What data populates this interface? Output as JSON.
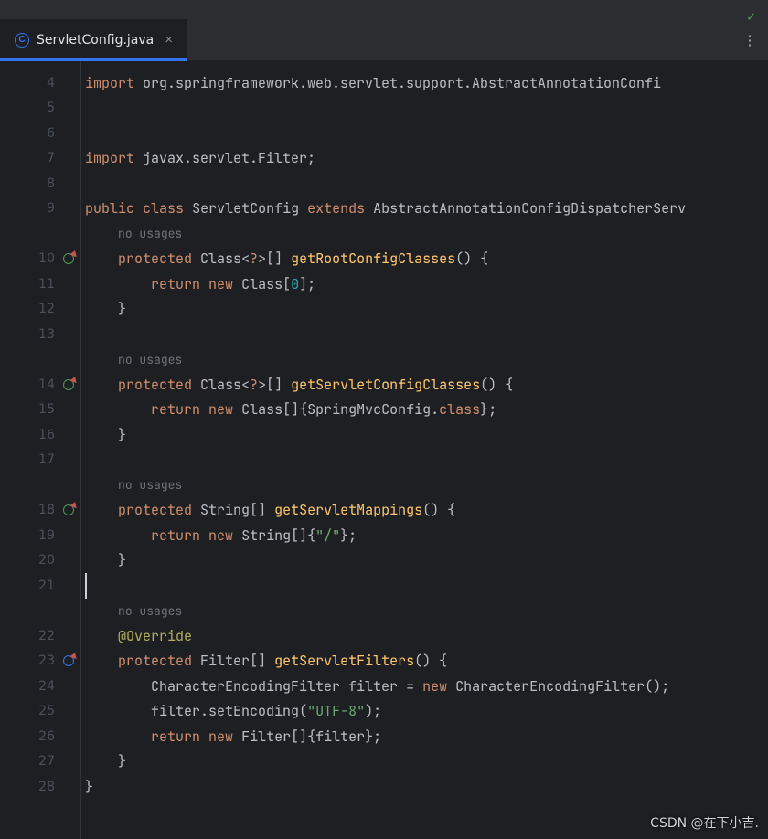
{
  "tab": {
    "icon_letter": "C",
    "title": "ServletConfig.java",
    "close_glyph": "×"
  },
  "tabbar": {
    "more_glyph": "⋮"
  },
  "status": {
    "check_glyph": "✓"
  },
  "hints": {
    "no_usages": "no usages"
  },
  "lines": {
    "l4": {
      "n": "4"
    },
    "l5": {
      "n": "5"
    },
    "l6": {
      "n": "6"
    },
    "l7": {
      "n": "7"
    },
    "l8": {
      "n": "8"
    },
    "l9": {
      "n": "9"
    },
    "l10": {
      "n": "10"
    },
    "l11": {
      "n": "11"
    },
    "l12": {
      "n": "12"
    },
    "l13": {
      "n": "13"
    },
    "l14": {
      "n": "14"
    },
    "l15": {
      "n": "15"
    },
    "l16": {
      "n": "16"
    },
    "l17": {
      "n": "17"
    },
    "l18": {
      "n": "18"
    },
    "l19": {
      "n": "19"
    },
    "l20": {
      "n": "20"
    },
    "l21": {
      "n": "21"
    },
    "l22": {
      "n": "22"
    },
    "l23": {
      "n": "23"
    },
    "l24": {
      "n": "24"
    },
    "l25": {
      "n": "25"
    },
    "l26": {
      "n": "26"
    },
    "l27": {
      "n": "27"
    },
    "l28": {
      "n": "28"
    }
  },
  "code": {
    "kw_import": "import",
    "kw_public": "public",
    "kw_class": "class",
    "kw_extends": "extends",
    "kw_protected": "protected",
    "kw_return": "return",
    "kw_new": "new",
    "ann_override": "@Override",
    "sp": " ",
    "pkg_spring": "org.springframework.web.servlet.support.AbstractAnnotationConfi",
    "pkg_filter": "javax.servlet.Filter;",
    "cls_ServletConfig": "ServletConfig",
    "cls_AbstractDispatcher": "AbstractAnnotationConfigDispatcherServ",
    "t_Class": "Class",
    "t_String": "String",
    "t_Filter": "Filter",
    "t_CEF": "CharacterEncodingFilter",
    "m_getRoot": "getRootConfigClasses",
    "m_getServletCfg": "getServletConfigClasses",
    "m_getMappings": "getServletMappings",
    "m_getFilters": "getServletFilters",
    "m_setEncoding": "setEncoding",
    "id_filter": "filter",
    "id_SpringMvc": "SpringMvcConfig",
    "kw_classref": "class",
    "s_utf8": "\"UTF-8\"",
    "s_slash": "\"/\"",
    "n_zero": "0",
    "p_lt": "<",
    "p_q": "?",
    "p_gt": ">",
    "p_arr": "[]",
    "p_lp": "(",
    "p_rp": ")",
    "p_lb": "{",
    "p_rb": "}",
    "p_lsq": "[",
    "p_rsq": "]",
    "p_semi": ";",
    "p_dot": ".",
    "p_eq": "=",
    "i1": "    ",
    "i2": "        ",
    "i3": "            "
  },
  "watermark": "CSDN @在下小吉."
}
